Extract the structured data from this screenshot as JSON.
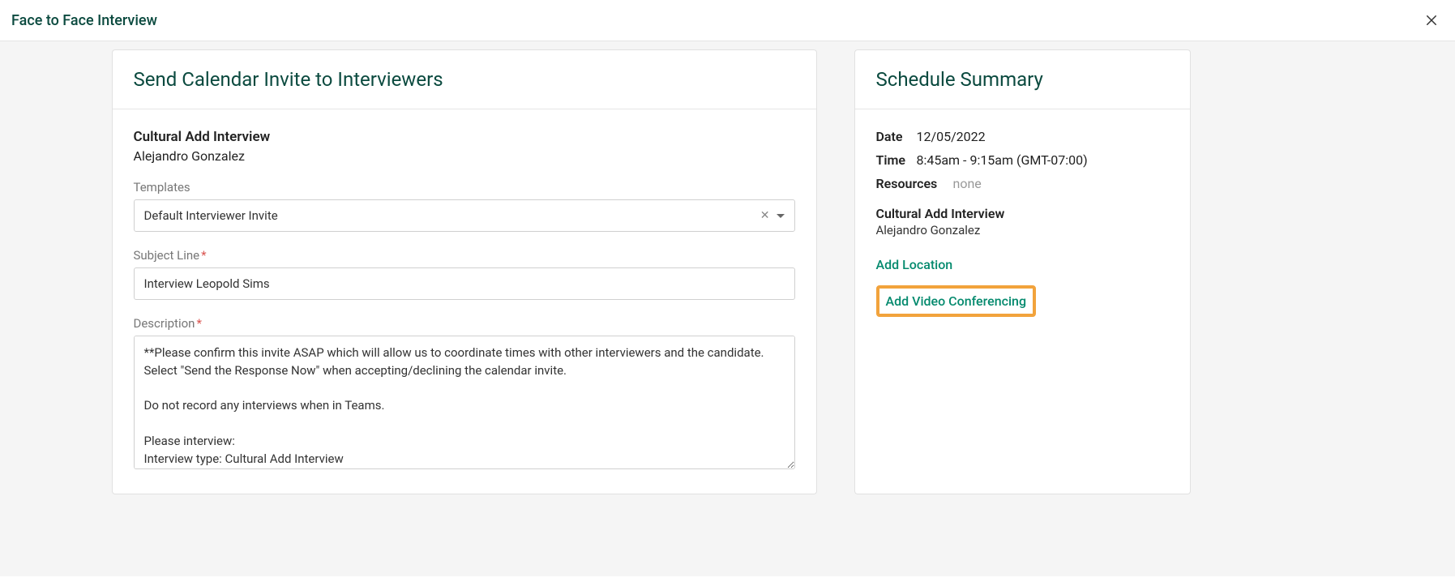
{
  "header": {
    "title": "Face to Face Interview"
  },
  "main": {
    "card_title": "Send Calendar Invite to Interviewers",
    "interview_title": "Cultural Add Interview",
    "candidate": "Alejandro Gonzalez",
    "templates": {
      "label": "Templates",
      "selected": "Default Interviewer Invite"
    },
    "subject": {
      "label": "Subject Line",
      "value": "Interview Leopold Sims"
    },
    "description": {
      "label": "Description",
      "value": "**Please confirm this invite ASAP which will allow us to coordinate times with other interviewers and the candidate. Select \"Send the Response Now\" when accepting/declining the calendar invite.\n\nDo not record any interviews when in Teams.\n\nPlease interview:\nInterview type: Cultural Add Interview"
    }
  },
  "summary": {
    "card_title": "Schedule Summary",
    "date_label": "Date",
    "date_value": "12/05/2022",
    "time_label": "Time",
    "time_value": "8:45am - 9:15am (GMT-07:00)",
    "resources_label": "Resources",
    "resources_value": "none",
    "interview_title": "Cultural Add Interview",
    "candidate": "Alejandro Gonzalez",
    "add_location": "Add Location",
    "add_video": "Add Video Conferencing"
  }
}
